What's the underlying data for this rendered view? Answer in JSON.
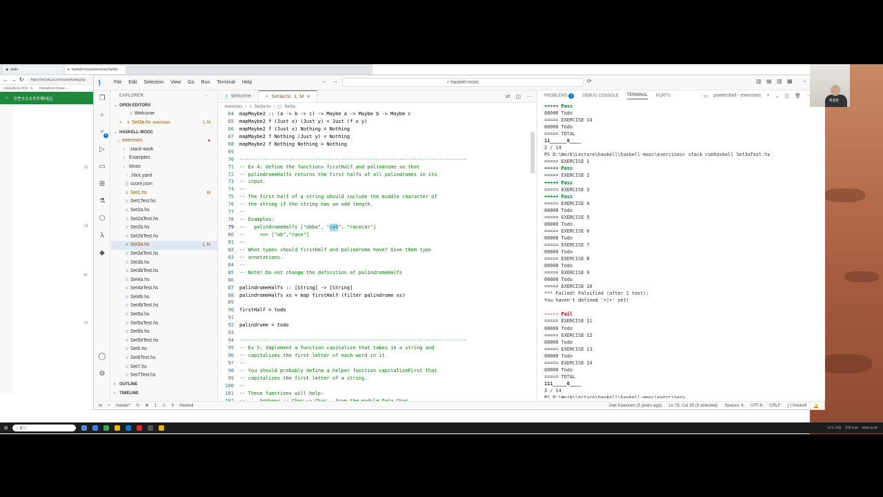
{
  "browser": {
    "tabs": [
      {
        "label": "plato"
      },
      {
        "label": "haskell-mooc/exercises/Set3a"
      }
    ],
    "url": "https://sel.jnu.ac.kr/course/view.php",
    "bookmarks": [
      "Kwanghoon Choi : S...",
      "Kwanghoon (Kwan..."
    ],
    "site_title": "오픈소스소프트웨어[2]",
    "side_numbers": [
      "13",
      "14",
      "M",
      "15"
    ]
  },
  "vscode": {
    "menu": [
      "File",
      "Edit",
      "Selection",
      "View",
      "Go",
      "Run",
      "Terminal",
      "Help"
    ],
    "search_text": "haskell-mooc",
    "explorer": {
      "title": "EXPLORER",
      "open_editors_label": "OPEN EDITORS",
      "open_editors": [
        {
          "name": "Welcome",
          "extra": "",
          "badge": ""
        },
        {
          "name": "Set3a.hs",
          "extra": "exercises",
          "badge": "1, M"
        }
      ],
      "project_label": "HASKELL-MOOC",
      "folder": "exercises",
      "items": [
        {
          "name": ".stack-work",
          "type": "folder",
          "badge": ""
        },
        {
          "name": "Examples",
          "type": "folder",
          "badge": ""
        },
        {
          "name": "Mooc",
          "type": "folder",
          "badge": ""
        },
        {
          "name": ".hlint.yaml",
          "type": "file",
          "badge": ""
        },
        {
          "name": "score.json",
          "type": "file",
          "badge": ""
        },
        {
          "name": "Set1.hs",
          "type": "file",
          "badge": "M"
        },
        {
          "name": "Set1Test.hs",
          "type": "file",
          "badge": ""
        },
        {
          "name": "Set2a.hs",
          "type": "file",
          "badge": ""
        },
        {
          "name": "Set2aTest.hs",
          "type": "file",
          "badge": ""
        },
        {
          "name": "Set2b.hs",
          "type": "file",
          "badge": ""
        },
        {
          "name": "Set2bTest.hs",
          "type": "file",
          "badge": ""
        },
        {
          "name": "Set3a.hs",
          "type": "file",
          "badge": "1, M"
        },
        {
          "name": "Set3aTest.hs",
          "type": "file",
          "badge": ""
        },
        {
          "name": "Set3b.hs",
          "type": "file",
          "badge": ""
        },
        {
          "name": "Set3bTest.hs",
          "type": "file",
          "badge": ""
        },
        {
          "name": "Set4a.hs",
          "type": "file",
          "badge": ""
        },
        {
          "name": "Set4aTest.hs",
          "type": "file",
          "badge": ""
        },
        {
          "name": "Set4b.hs",
          "type": "file",
          "badge": ""
        },
        {
          "name": "Set4bTest.hs",
          "type": "file",
          "badge": ""
        },
        {
          "name": "Set5a.hs",
          "type": "file",
          "badge": ""
        },
        {
          "name": "Set5aTest.hs",
          "type": "file",
          "badge": ""
        },
        {
          "name": "Set5b.hs",
          "type": "file",
          "badge": ""
        },
        {
          "name": "Set5bTest.hs",
          "type": "file",
          "badge": ""
        },
        {
          "name": "Set6.hs",
          "type": "file",
          "badge": ""
        },
        {
          "name": "Set6Test.hs",
          "type": "file",
          "badge": ""
        },
        {
          "name": "Set7.hs",
          "type": "file",
          "badge": ""
        },
        {
          "name": "Set7Test.hs",
          "type": "file",
          "badge": ""
        }
      ],
      "outline_label": "OUTLINE",
      "timeline_label": "TIMELINE"
    },
    "tabs": [
      {
        "label": "Welcome",
        "badge": ""
      },
      {
        "label": "Set3a.hs",
        "badge": "1, M"
      }
    ],
    "breadcrumb": [
      "exercises",
      "Set3a.hs",
      "Set3a"
    ],
    "code_lines": [
      {
        "n": "64",
        "text": "mapMaybe2 :: (a -> b -> c) -> Maybe a -> Maybe b -> Maybe c",
        "kind": "code"
      },
      {
        "n": "65",
        "text": "mapMaybe2 f (Just x) (Just y) = Just (f x y)",
        "kind": "code"
      },
      {
        "n": "66",
        "text": "mapMaybe2 f (Just x) Nothing = Nothing",
        "kind": "code"
      },
      {
        "n": "67",
        "text": "mapMaybe2 f Nothing (Just y) = Nothing",
        "kind": "code"
      },
      {
        "n": "68",
        "text": "mapMaybe2 f Nothing Nothing = Nothing",
        "kind": "code"
      },
      {
        "n": "69",
        "text": "",
        "kind": "code"
      },
      {
        "n": "70",
        "text": "------------------------------------------------------------------------------",
        "kind": "comment"
      },
      {
        "n": "71",
        "text": "-- Ex 4: define the functions firstHalf and palindrome so that",
        "kind": "comment"
      },
      {
        "n": "72",
        "text": "-- palindromeHalfs returns the first halfs of all palindromes in its",
        "kind": "comment"
      },
      {
        "n": "73",
        "text": "-- input.",
        "kind": "comment"
      },
      {
        "n": "74",
        "text": "--",
        "kind": "comment"
      },
      {
        "n": "75",
        "text": "-- The first half of a string should include the middle character of",
        "kind": "comment"
      },
      {
        "n": "76",
        "text": "-- the string if the string has an odd length.",
        "kind": "comment"
      },
      {
        "n": "77",
        "text": "--",
        "kind": "comment"
      },
      {
        "n": "78",
        "text": "-- Examples:",
        "kind": "comment"
      },
      {
        "n": "79",
        "text": "--   palindromeHalfs [\"abba\", \"",
        "kind": "comment-sel",
        "sel": "cat",
        "after": "\", \"racecar\"]"
      },
      {
        "n": "80",
        "text": "--     ==> [\"ab\",\"race\"]",
        "kind": "comment"
      },
      {
        "n": "81",
        "text": "--",
        "kind": "comment"
      },
      {
        "n": "82",
        "text": "-- What types should firstHalf and palindrome have? Give them type",
        "kind": "comment"
      },
      {
        "n": "83",
        "text": "-- annotations.",
        "kind": "comment"
      },
      {
        "n": "84",
        "text": "--",
        "kind": "comment"
      },
      {
        "n": "85",
        "text": "-- Note! Do not change the definition of palindromeHalfs",
        "kind": "comment"
      },
      {
        "n": "86",
        "text": "",
        "kind": "code"
      },
      {
        "n": "87",
        "text": "palindromeHalfs :: [String] -> [String]",
        "kind": "code"
      },
      {
        "n": "88",
        "text": "palindromeHalfs xs = map firstHalf (filter palindrome xs)",
        "kind": "code"
      },
      {
        "n": "89",
        "text": "",
        "kind": "code"
      },
      {
        "n": "90",
        "text": "firstHalf = todo",
        "kind": "code"
      },
      {
        "n": "91",
        "text": "",
        "kind": "code"
      },
      {
        "n": "92",
        "text": "palindrome = todo",
        "kind": "code"
      },
      {
        "n": "93",
        "text": "",
        "kind": "code"
      },
      {
        "n": "94",
        "text": "------------------------------------------------------------------------------",
        "kind": "comment"
      },
      {
        "n": "95",
        "text": "-- Ex 5: Implement a function capitalize that takes in a string and",
        "kind": "comment"
      },
      {
        "n": "96",
        "text": "-- capitalizes the first letter of each word in it.",
        "kind": "comment"
      },
      {
        "n": "97",
        "text": "--",
        "kind": "comment"
      },
      {
        "n": "98",
        "text": "-- You should probably define a helper function capitalizeFirst that",
        "kind": "comment"
      },
      {
        "n": "99",
        "text": "-- capitalizes the first letter of a string.",
        "kind": "comment"
      },
      {
        "n": "100",
        "text": "--",
        "kind": "comment"
      },
      {
        "n": "101",
        "text": "-- These functions will help:",
        "kind": "comment"
      },
      {
        "n": "102",
        "text": "--     toUpper :: Char -> Char   from the module Data.Char",
        "kind": "comment"
      }
    ],
    "panel": {
      "tabs": [
        {
          "label": "PROBLEMS",
          "badge": "1"
        },
        {
          "label": "DEBUG CONSOLE",
          "badge": ""
        },
        {
          "label": "TERMINAL",
          "badge": ""
        },
        {
          "label": "PORTS",
          "badge": ""
        }
      ],
      "shell_label": "powershell - exercises",
      "terminal_lines": [
        {
          "t": "+++++ Pass",
          "k": "pass"
        },
        {
          "t": "00000 Todo",
          "k": ""
        },
        {
          "t": "===== EXERCISE 14",
          "k": ""
        },
        {
          "t": "00000 Todo",
          "k": ""
        },
        {
          "t": "===== TOTAL",
          "k": ""
        },
        {
          "t": "11______0____",
          "k": "bold"
        },
        {
          "t": "2 / 14",
          "k": ""
        },
        {
          "t": "PS D:\\Work\\Lecture\\haskell\\haskell-mooc\\exercises> stack runhaskell Set3aTest.hs",
          "k": ""
        },
        {
          "t": "===== EXERCISE 1",
          "k": ""
        },
        {
          "t": "+++++ Pass",
          "k": "pass"
        },
        {
          "t": "===== EXERCISE 2",
          "k": ""
        },
        {
          "t": "+++++ Pass",
          "k": "pass"
        },
        {
          "t": "===== EXERCISE 3",
          "k": ""
        },
        {
          "t": "+++++ Pass",
          "k": "pass"
        },
        {
          "t": "===== EXERCISE 4",
          "k": ""
        },
        {
          "t": "00000 Todo",
          "k": ""
        },
        {
          "t": "===== EXERCISE 5",
          "k": ""
        },
        {
          "t": "00000 Todo",
          "k": ""
        },
        {
          "t": "===== EXERCISE 6",
          "k": ""
        },
        {
          "t": "00000 Todo",
          "k": ""
        },
        {
          "t": "===== EXERCISE 7",
          "k": ""
        },
        {
          "t": "00000 Todo",
          "k": ""
        },
        {
          "t": "===== EXERCISE 8",
          "k": ""
        },
        {
          "t": "00000 Todo",
          "k": ""
        },
        {
          "t": "===== EXERCISE 9",
          "k": ""
        },
        {
          "t": "00000 Todo",
          "k": ""
        },
        {
          "t": "===== EXERCISE 10",
          "k": ""
        },
        {
          "t": "*** Failed! Falsified (after 1 test):",
          "k": ""
        },
        {
          "t": "You haven't defined '+|+' yet!",
          "k": ""
        },
        {
          "t": "",
          "k": ""
        },
        {
          "t": "----- Fail",
          "k": "fail"
        },
        {
          "t": "===== EXERCISE 11",
          "k": ""
        },
        {
          "t": "00000 Todo",
          "k": ""
        },
        {
          "t": "===== EXERCISE 12",
          "k": ""
        },
        {
          "t": "00000 Todo",
          "k": ""
        },
        {
          "t": "===== EXERCISE 13",
          "k": ""
        },
        {
          "t": "00000 Todo",
          "k": ""
        },
        {
          "t": "===== EXERCISE 14",
          "k": ""
        },
        {
          "t": "00000 Todo",
          "k": ""
        },
        {
          "t": "===== TOTAL",
          "k": ""
        },
        {
          "t": "111_____0____",
          "k": "bold"
        },
        {
          "t": "3 / 14",
          "k": ""
        },
        {
          "t": "PS D:\\Work\\Lecture\\haskell\\haskell-mooc\\exercises> ",
          "k": ""
        }
      ]
    },
    "status": {
      "branch": "master*",
      "errors": "1",
      "warnings": "0",
      "language_left": "Haskell",
      "blame": "Joel Kaasinen (5 years ago)",
      "position": "Ln 79, Col 35 (3 selected)",
      "spaces": "Spaces: 4",
      "encoding": "UTF-8",
      "eol": "CRLF",
      "language": "Haskell"
    }
  },
  "webcam_label": "최광훈",
  "taskbar": {
    "search": "찾기",
    "weather": "13°C 흐림",
    "time": "오후 6:34",
    "date": "2025-11-20"
  }
}
